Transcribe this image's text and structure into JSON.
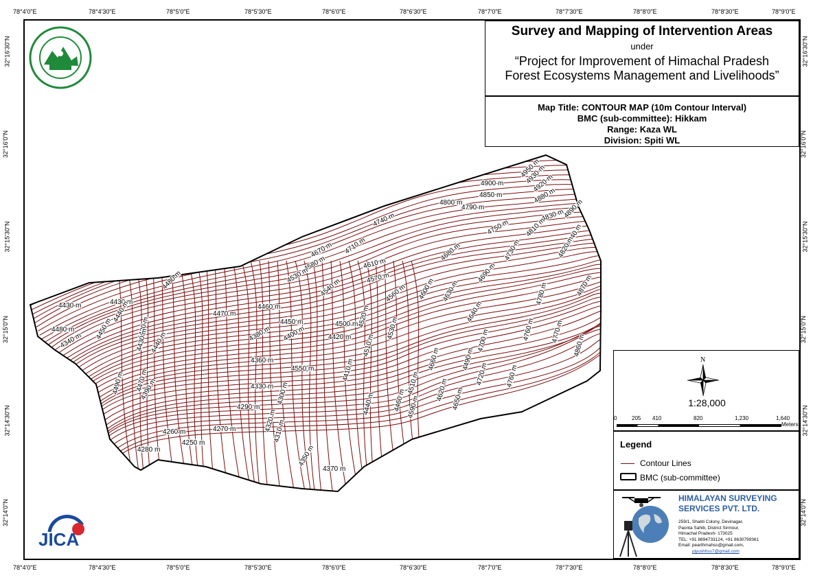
{
  "title": {
    "main": "Survey and Mapping of Intervention Areas",
    "under": "under",
    "project_line1": "“Project for Improvement of Himachal Pradesh",
    "project_line2": "Forest Ecosystems Management and Livelihoods”"
  },
  "info": {
    "map_title": "Map Title: CONTOUR MAP (10m Contour Interval)",
    "bmc": "BMC (sub-committee): Hikkam",
    "range": "Range: Kaza WL",
    "division": "Division: Spiti WL"
  },
  "scale": {
    "north": "N",
    "ratio": "1:28,000",
    "ticks": [
      "0",
      "205",
      "410",
      "820",
      "1,230",
      "1,640"
    ],
    "unit": "Meters"
  },
  "legend": {
    "title": "Legend",
    "items": [
      {
        "label": "Contour Lines",
        "color": "#7a0a0a"
      },
      {
        "label": "BMC (sub-committee)",
        "color": "#000000"
      }
    ]
  },
  "company": {
    "name_line1": "HIMALAYAN SURVEYING",
    "name_line2": "SERVICES PVT. LTD.",
    "address": [
      "259/1, Shakti Colony, Devinagar,",
      "Paonta Sahib, District Sirmour,",
      "Himachal Pradesh- 173025",
      "TEL: +91 8894733124, +91 8630799361",
      "Email: pearthmahss@gmail.com,",
      "pjyushhss7@gmail.com"
    ],
    "name_color": "#2d5fa0"
  },
  "graticule": {
    "lon": [
      "78°4'0\"E",
      "78°4'30\"E",
      "78°5'0\"E",
      "78°5'30\"E",
      "78°6'0\"E",
      "78°6'30\"E",
      "78°7'0\"E",
      "78°7'30\"E",
      "78°8'0\"E",
      "78°8'30\"E",
      "78°9'0\"E"
    ],
    "lat": [
      "32°16'30\"N",
      "32°16'0\"N",
      "32°15'30\"N",
      "32°15'0\"N",
      "32°14'30\"N",
      "32°14'0\"N"
    ]
  },
  "contour_labels": [
    "4950 m",
    "4930 m",
    "4920 m",
    "4900 m",
    "4850 m",
    "4880 m",
    "4800 m",
    "4790 m",
    "4830 m",
    "4890 m",
    "4740 m",
    "4750 m",
    "4810 m",
    "4840 m",
    "4820 m",
    "4710 m",
    "4670 m",
    "4730 m",
    "4610 m",
    "4580 m",
    "4680 m",
    "4570 m",
    "4530 m",
    "4690 m",
    "4480 m",
    "4540 m",
    "4560 m",
    "4600 m",
    "4630 m",
    "4870 m",
    "4430 m",
    "4430 m",
    "4470 m",
    "4460 m",
    "4520 m",
    "4640 m",
    "4780 m",
    "4440 m",
    "4480 m",
    "4450 m",
    "4430 m",
    "4440 m",
    "4450 m",
    "4500 m",
    "4420 m",
    "4380 m",
    "4400 m",
    "4530 m",
    "4340 m",
    "4430 m",
    "4700 m",
    "4760 m",
    "4770 m",
    "4860 m",
    "4510 m",
    "4360 m",
    "4550 m",
    "4660 m",
    "4490 m",
    "4470 m",
    "4410 m",
    "4510 m",
    "4620 m",
    "4720 m",
    "4760 m",
    "4390 m",
    "4330 m",
    "4460 m",
    "4290 m",
    "4300 m",
    "4650 m",
    "4440 m",
    "4490 m",
    "4590 m",
    "4260 m",
    "4270 m",
    "4320 m",
    "4310 m",
    "4280 m",
    "4250 m",
    "4350 m",
    "4370 m"
  ],
  "map_colors": {
    "contour": "#7a0a0a",
    "boundary": "#000000",
    "logo_green": "#1f8a3a",
    "jica_blue": "#1a4a9c",
    "jica_red": "#d7282f"
  }
}
